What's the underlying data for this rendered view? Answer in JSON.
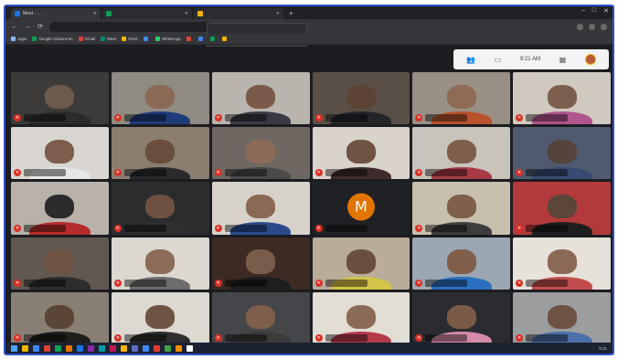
{
  "browser": {
    "tabs": [
      {
        "title": "Meet - ...",
        "color": "#1a73e8"
      },
      {
        "title": "",
        "color": "#0f9d58"
      },
      {
        "title": "",
        "color": "#f4b400"
      }
    ],
    "address": "",
    "popup": {
      "line1": "",
      "line2": ""
    },
    "bookmarks": [
      {
        "label": "Apps",
        "color": "#8ab4f8"
      },
      {
        "label": "Google Classroom",
        "color": "#0f9d58"
      },
      {
        "label": "Gmail",
        "color": "#db4437"
      },
      {
        "label": "Meet",
        "color": "#00897b"
      },
      {
        "label": "Drive",
        "color": "#f4b400"
      },
      {
        "label": "",
        "color": "#4285f4"
      },
      {
        "label": "WhatsApp",
        "color": "#25d366"
      },
      {
        "label": "",
        "color": "#db4437"
      },
      {
        "label": "",
        "color": "#4285f4"
      },
      {
        "label": "",
        "color": "#0f9d58"
      },
      {
        "label": "",
        "color": "#f4b400"
      }
    ]
  },
  "meet": {
    "time": "9:21 AM",
    "avatar_color": "#b55a3a",
    "participants": [
      {
        "head": "#6b5a4d",
        "body": "#2b2b2b",
        "bg": "#3c3b3a"
      },
      {
        "head": "#8a6a55",
        "body": "#1f3c7a",
        "bg": "#8f8a82"
      },
      {
        "head": "#7a5a48",
        "body": "#3a3a44",
        "bg": "#b9b4ad"
      },
      {
        "head": "#5c4437",
        "body": "#23252a",
        "bg": "#5a4f46"
      },
      {
        "head": "#8d6b55",
        "body": "#b7522c",
        "bg": "#9a8f84"
      },
      {
        "head": "#7c5f4d",
        "body": "#b1568c",
        "bg": "#cfc9c0"
      },
      {
        "head": "#7d5e4c",
        "body": "#e6e6e6",
        "bg": "#d9d6d1"
      },
      {
        "head": "#6a4e3e",
        "body": "#2a2a2a",
        "bg": "#8b7d70"
      },
      {
        "head": "#8b6a57",
        "body": "#4a4a4a",
        "bg": "#6f6862"
      },
      {
        "head": "#6f5241",
        "body": "#3e2a2a",
        "bg": "#d9d3cb"
      },
      {
        "head": "#7e5f4c",
        "body": "#a63b46",
        "bg": "#c8c3bb"
      },
      {
        "head": "#55443b",
        "body": "#3a4a72",
        "bg": "#4f5a6e"
      },
      {
        "head": "#2b2b2b",
        "body": "#b52c2c",
        "bg": "#b8b2aa"
      },
      {
        "head": "#6d5040",
        "body": "#2f2f2f",
        "bg": "#2b2c2e"
      },
      {
        "head": "#8a6955",
        "body": "#2c4a8a",
        "bg": "#d7d2ca"
      },
      {
        "letter": "M",
        "bg": "#202124"
      },
      {
        "head": "#7f604d",
        "body": "#3d3d3d",
        "bg": "#c9bfae"
      },
      {
        "head": "#5c463a",
        "body": "#1f1f1f",
        "bg": "#b33a3a"
      },
      {
        "head": "#6f5343",
        "body": "#2d2d2d",
        "bg": "#615851"
      },
      {
        "head": "#8b6c58",
        "body": "#6d6d6d",
        "bg": "#dcd7cf"
      },
      {
        "head": "#7a5c4a",
        "body": "#1e1e1e",
        "bg": "#3d2a22"
      },
      {
        "head": "#6a4f40",
        "body": "#d4c449",
        "bg": "#b9ad9a"
      },
      {
        "head": "#805f4b",
        "body": "#2a6fc0",
        "bg": "#9aa7b2"
      },
      {
        "head": "#8a6a56",
        "body": "#c24d4d",
        "bg": "#e6e1d9"
      },
      {
        "head": "#5b4537",
        "body": "#1f1f1f",
        "bg": "#8a7f74"
      },
      {
        "head": "#6f5444",
        "body": "#2e2e2e",
        "bg": "#dcd8d2"
      },
      {
        "head": "#7d5f4c",
        "body": "#3b3b3b",
        "bg": "#44464a"
      },
      {
        "head": "#8b6b57",
        "body": "#b33a4a",
        "bg": "#e2ddd5"
      },
      {
        "head": "#7a5b48",
        "body": "#d48aa8",
        "bg": "#2b2c30"
      },
      {
        "head": "#6e5243",
        "body": "#4b6fa8",
        "bg": "#9c9d9f"
      }
    ]
  },
  "taskbar": {
    "time": "9:21",
    "date": "",
    "apps": [
      "#f4b400",
      "#4285f4",
      "#db4437",
      "#0f9d58",
      "#e37400",
      "#1a73e8",
      "#8e24aa",
      "#0097a7",
      "#c2185b",
      "#f4b400",
      "#5c6bc0",
      "#4285f4",
      "#e53935",
      "#43a047",
      "#fb8c00",
      "#ffffff"
    ]
  }
}
